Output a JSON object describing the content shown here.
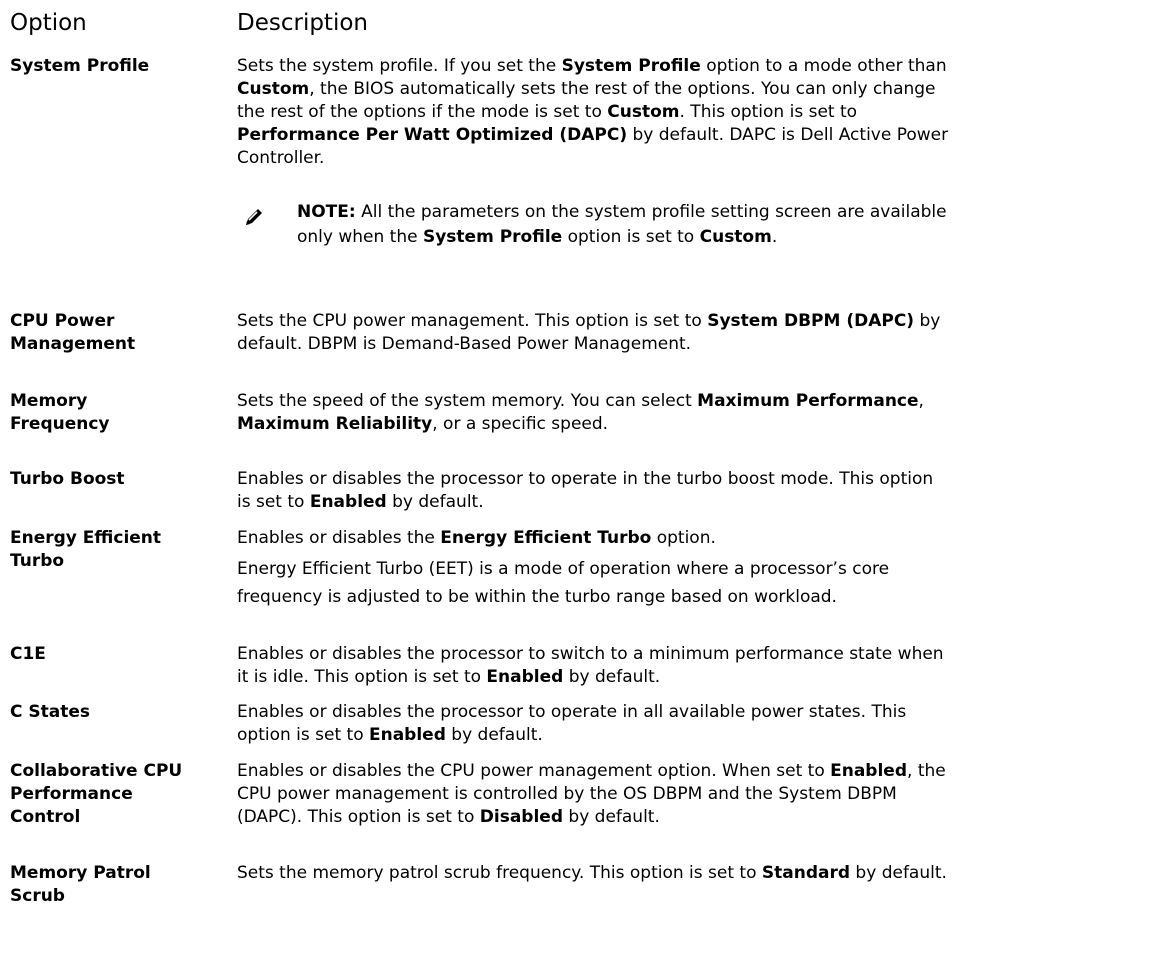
{
  "header": {
    "option": "Option",
    "description": "Description"
  },
  "rows": [
    {
      "label": "System Profile",
      "lines": [
        [
          [
            "Sets the system profile. If you set the ",
            false
          ],
          [
            "System Profile",
            true
          ],
          [
            " option to a mode other than",
            false
          ]
        ],
        [
          [
            "Custom",
            true
          ],
          [
            ", the BIOS automatically sets the rest of the options. You can only change",
            false
          ]
        ],
        [
          [
            "the rest of the options if the mode is set to ",
            false
          ],
          [
            "Custom",
            true
          ],
          [
            ". This option is set to",
            false
          ]
        ],
        [
          [
            "Performance Per Watt Optimized (DAPC)",
            true
          ],
          [
            " by default. DAPC is Dell Active Power",
            false
          ]
        ],
        [
          [
            "Controller.",
            false
          ]
        ]
      ],
      "note": {
        "icon": "note-pencil-icon",
        "lines": [
          [
            [
              "NOTE:",
              true
            ],
            [
              " All the parameters on the system profile setting screen are available",
              false
            ]
          ],
          [
            [
              "only when the ",
              false
            ],
            [
              "System Profile",
              true
            ],
            [
              " option is set to ",
              false
            ],
            [
              "Custom",
              true
            ],
            [
              ".",
              false
            ]
          ]
        ]
      }
    },
    {
      "label": "CPU Power Management",
      "label_lines": [
        "CPU Power",
        "Management"
      ],
      "lines": [
        [
          [
            "Sets the CPU power management. This option is set to ",
            false
          ],
          [
            "System DBPM (DAPC)",
            true
          ],
          [
            " by",
            false
          ]
        ],
        [
          [
            "default. DBPM is Demand-Based Power Management.",
            false
          ]
        ]
      ]
    },
    {
      "label": "Memory Frequency",
      "label_lines": [
        "Memory",
        "Frequency"
      ],
      "lines": [
        [
          [
            "Sets the speed of the system memory. You can select ",
            false
          ],
          [
            "Maximum Performance",
            true
          ],
          [
            ",",
            false
          ]
        ],
        [
          [
            "Maximum Reliability",
            true
          ],
          [
            ", or a specific speed.",
            false
          ]
        ]
      ]
    },
    {
      "label": "Turbo Boost",
      "label_lines": [
        "Turbo Boost"
      ],
      "lines": [
        [
          [
            "Enables or disables the processor to operate in the turbo boost mode. This option",
            false
          ]
        ],
        [
          [
            "is set to ",
            false
          ],
          [
            "Enabled",
            true
          ],
          [
            " by default.",
            false
          ]
        ]
      ]
    },
    {
      "label": "Energy Efficient Turbo",
      "label_lines": [
        "Energy Efficient",
        "Turbo"
      ],
      "lines": [
        [
          [
            "Enables or disables the ",
            false
          ],
          [
            "Energy Efficient Turbo",
            true
          ],
          [
            " option.",
            false
          ]
        ]
      ],
      "extra_lines": [
        [
          [
            "Energy Efficient Turbo (EET) is a mode of operation where a processor’s core",
            false
          ]
        ],
        [
          [
            "frequency is adjusted to be within the turbo range based on workload.",
            false
          ]
        ]
      ]
    },
    {
      "label": "C1E",
      "label_lines": [
        "C1E"
      ],
      "lines": [
        [
          [
            "Enables or disables the processor to switch to a minimum performance state when",
            false
          ]
        ],
        [
          [
            "it is idle. This option is set to ",
            false
          ],
          [
            "Enabled",
            true
          ],
          [
            " by default.",
            false
          ]
        ]
      ]
    },
    {
      "label": "C States",
      "label_lines": [
        "C States"
      ],
      "lines": [
        [
          [
            "Enables or disables the processor to operate in all available power states. This",
            false
          ]
        ],
        [
          [
            "option is set to ",
            false
          ],
          [
            "Enabled",
            true
          ],
          [
            " by default.",
            false
          ]
        ]
      ]
    },
    {
      "label": "Collaborative CPU Performance Control",
      "label_lines": [
        "Collaborative CPU",
        "Performance",
        "Control"
      ],
      "lines": [
        [
          [
            "Enables or disables the CPU power management option. When set to ",
            false
          ],
          [
            "Enabled",
            true
          ],
          [
            ", the",
            false
          ]
        ],
        [
          [
            "CPU power management is controlled by the OS DBPM and the System DBPM",
            false
          ]
        ],
        [
          [
            "(DAPC). This option is set to ",
            false
          ],
          [
            "Disabled",
            true
          ],
          [
            " by default.",
            false
          ]
        ]
      ]
    },
    {
      "label": "Memory Patrol Scrub",
      "label_lines": [
        "Memory Patrol",
        "Scrub"
      ],
      "lines": [
        [
          [
            "Sets the memory patrol scrub frequency. This option is set to ",
            false
          ],
          [
            "Standard",
            true
          ],
          [
            " by default.",
            false
          ]
        ]
      ]
    }
  ]
}
